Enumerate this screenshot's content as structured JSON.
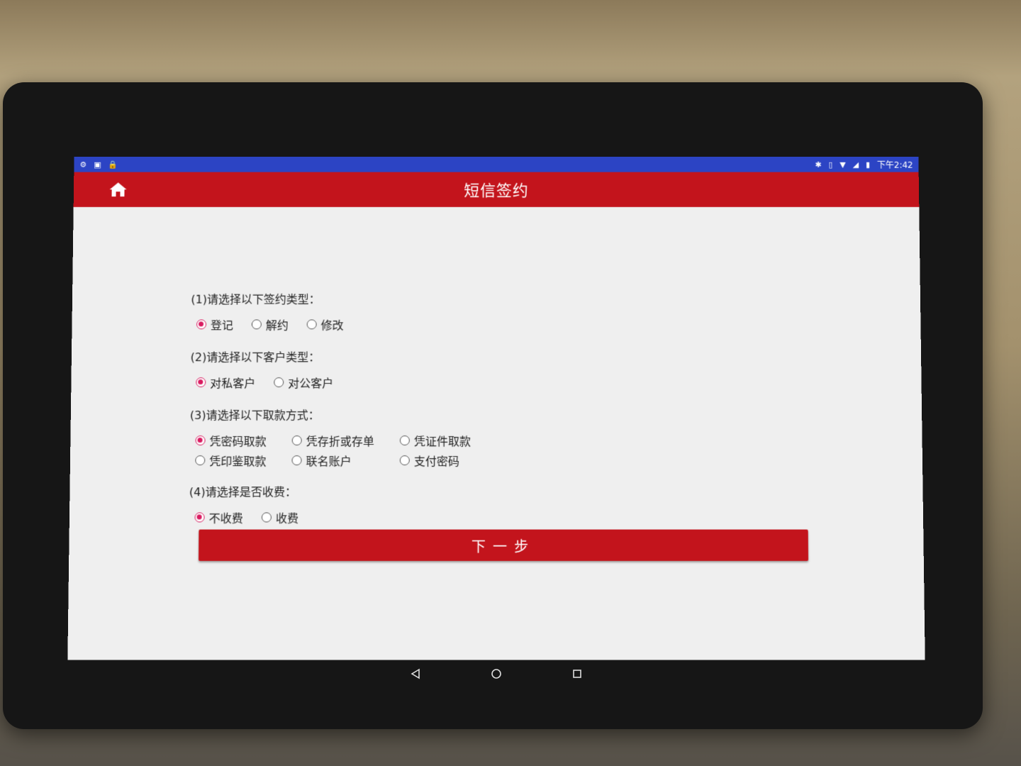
{
  "status_bar": {
    "time": "下午2:42",
    "left_icons": [
      "settings-icon",
      "gallery-icon",
      "lock-icon"
    ],
    "right_icons": [
      "bluetooth-icon",
      "vibrate-icon",
      "wifi-icon",
      "signal-icon",
      "battery-icon"
    ]
  },
  "header": {
    "title": "短信签约",
    "home_icon": "home-icon",
    "bg_color": "#c3141c"
  },
  "form": {
    "q1": {
      "label": "(1)请选择以下签约类型：",
      "options": [
        "登记",
        "解约",
        "修改"
      ],
      "selected": "登记"
    },
    "q2": {
      "label": "(2)请选择以下客户类型：",
      "options": [
        "对私客户",
        "对公客户"
      ],
      "selected": "对私客户"
    },
    "q3": {
      "label": "(3)请选择以下取款方式：",
      "options": [
        "凭密码取款",
        "凭存折或存单",
        "凭证件取款",
        "凭印鉴取款",
        "联名账户",
        "支付密码"
      ],
      "selected": "凭密码取款"
    },
    "q4": {
      "label": "(4)请选择是否收费：",
      "options": [
        "不收费",
        "收费"
      ],
      "selected": "不收费"
    }
  },
  "next_button": {
    "label": "下一步"
  },
  "nav": {
    "icons": [
      "back-icon",
      "home-circle-icon",
      "recents-icon"
    ]
  },
  "colors": {
    "accent": "#c3141c",
    "status_bar": "#2c44c4",
    "radio_selected": "#d81b60"
  }
}
